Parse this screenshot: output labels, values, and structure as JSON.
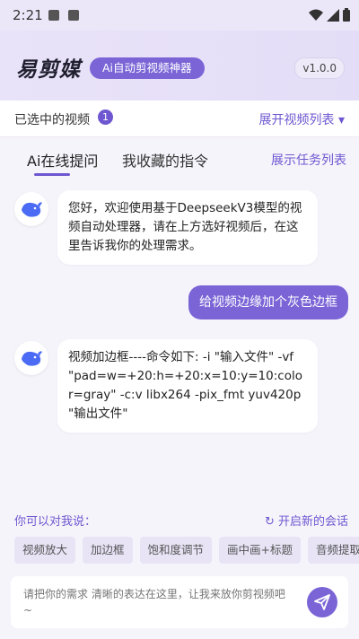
{
  "status_bar": {
    "time": "2:21"
  },
  "header": {
    "app_name": "易剪媒",
    "slogan": "Ai自动剪视频神器",
    "version": "v1.0.0"
  },
  "video_bar": {
    "selected_label": "已选中的视频",
    "selected_count": "1",
    "expand_label": "展开视频列表 ▾"
  },
  "tabs": {
    "items": [
      {
        "label": "Ai在线提问"
      },
      {
        "label": "我收藏的指令"
      }
    ],
    "task_link": "展示任务列表"
  },
  "chat": {
    "messages": [
      {
        "role": "bot",
        "text": "您好，欢迎使用基于DeepseekV3模型的视频自动处理器，请在上方选好视频后，在这里告诉我你的处理需求。"
      },
      {
        "role": "user",
        "text": "给视频边缘加个灰色边框"
      },
      {
        "role": "bot",
        "text": "视频加边框----命令如下: -i \"输入文件\" -vf \"pad=w=+20:h=+20:x=10:y=10:color=gray\" -c:v libx264 -pix_fmt yuv420p \"输出文件\""
      }
    ]
  },
  "suggestions": {
    "title": "你可以对我说：",
    "new_session": "↻ 开启新的会话",
    "chips": [
      "视频放大",
      "加边框",
      "饱和度调节",
      "画中画+标题",
      "音频提取"
    ]
  },
  "input": {
    "placeholder": "请把你的需求 清晰的表达在这里，让我来放你剪视频吧~"
  },
  "colors": {
    "accent": "#7b64d6",
    "accent_dark": "#6e57d0",
    "background": "#f6f4fb"
  },
  "icons": {
    "avatar": "deepseek-whale-icon",
    "send": "send-arrow-icon"
  }
}
